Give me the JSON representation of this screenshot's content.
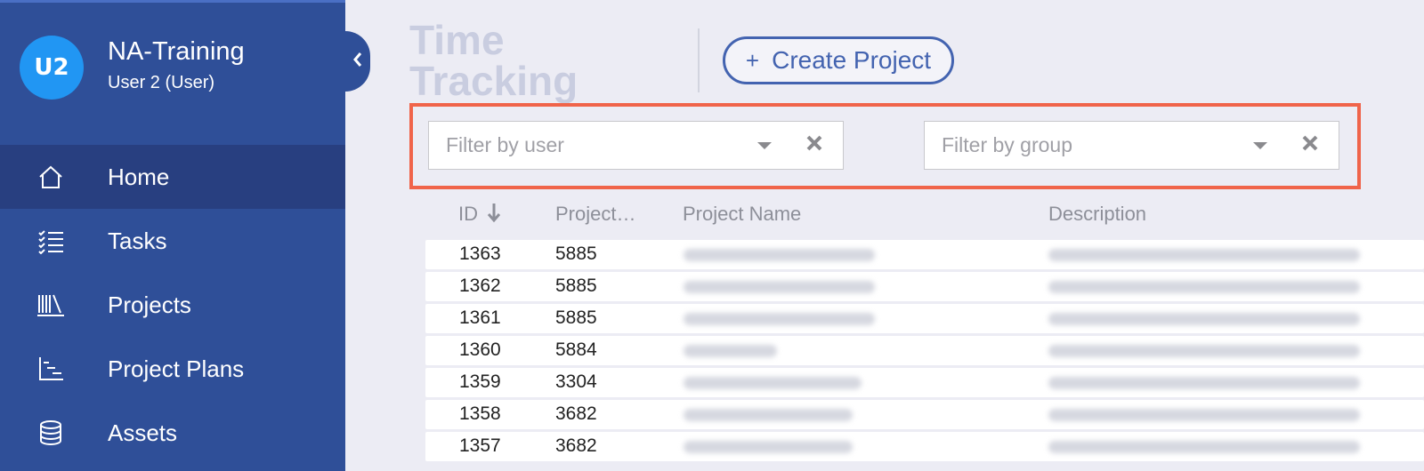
{
  "sidebar": {
    "avatar": "U2",
    "org_name": "NA-Training",
    "user_role": "User 2 (User)",
    "nav": [
      {
        "label": "Home",
        "icon": "home-icon",
        "active": true
      },
      {
        "label": "Tasks",
        "icon": "checklist-icon"
      },
      {
        "label": "Projects",
        "icon": "books-icon"
      },
      {
        "label": "Project Plans",
        "icon": "gantt-icon"
      },
      {
        "label": "Assets",
        "icon": "database-icon"
      }
    ]
  },
  "header": {
    "title": "Time Tracking",
    "create_button": "Create Project"
  },
  "filters": {
    "user_placeholder": "Filter by user",
    "group_placeholder": "Filter by group"
  },
  "table": {
    "columns": [
      "ID",
      "Project…",
      "Project Name",
      "Description"
    ],
    "rows": [
      {
        "id": "1363",
        "project": "5885"
      },
      {
        "id": "1362",
        "project": "5885"
      },
      {
        "id": "1361",
        "project": "5885"
      },
      {
        "id": "1360",
        "project": "5884"
      },
      {
        "id": "1359",
        "project": "3304"
      },
      {
        "id": "1358",
        "project": "3682"
      },
      {
        "id": "1357",
        "project": "3682"
      }
    ]
  },
  "colors": {
    "sidebar": "#2f4f98",
    "accent": "#4363b0",
    "highlight": "#f0644a",
    "avatar": "#2196f3"
  }
}
